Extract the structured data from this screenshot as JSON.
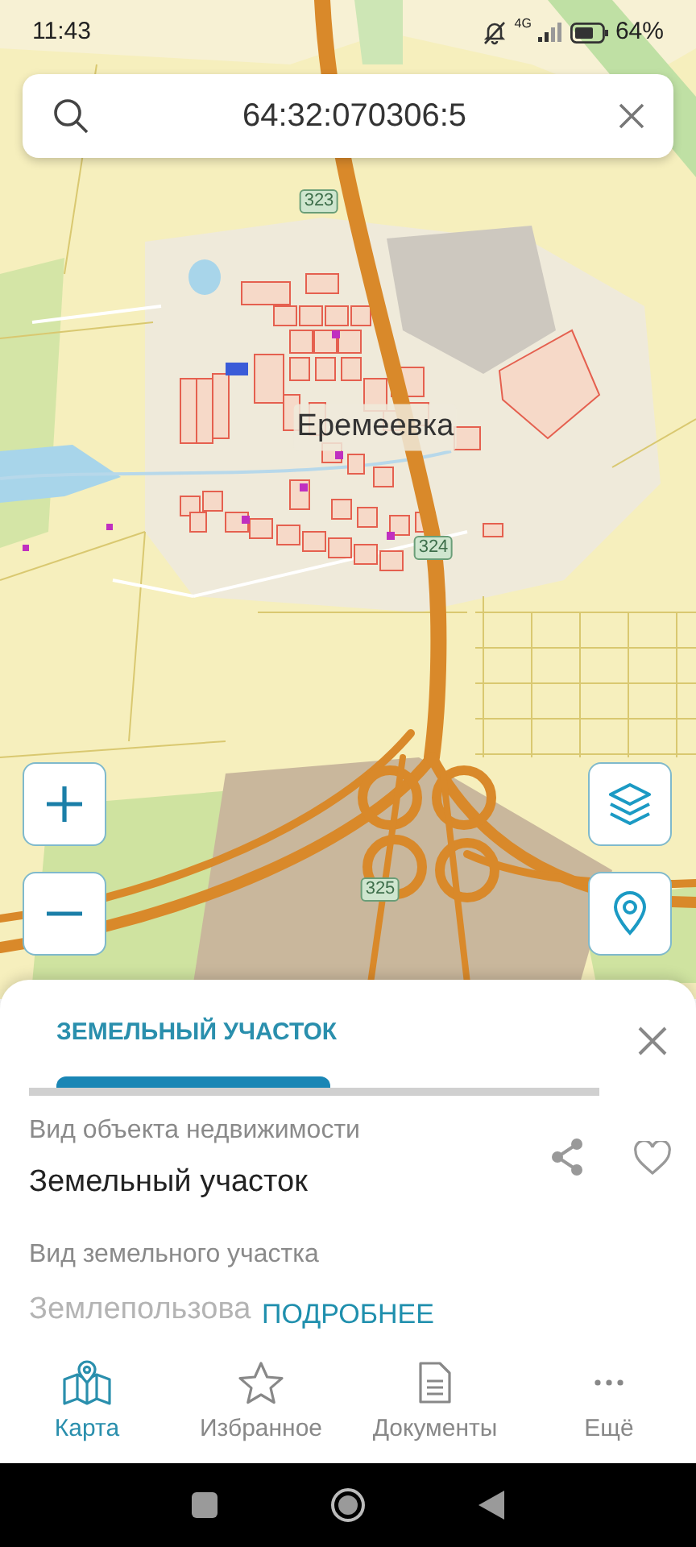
{
  "status_bar": {
    "time": "11:43",
    "network": "4G",
    "battery": "64%"
  },
  "search": {
    "value": "64:32:070306:5"
  },
  "map": {
    "labels": [
      {
        "kind": "road",
        "text": "323"
      },
      {
        "kind": "place",
        "text": "Еремеевка"
      },
      {
        "kind": "road",
        "text": "324"
      },
      {
        "kind": "road",
        "text": "325"
      }
    ]
  },
  "sheet": {
    "tabs": [
      {
        "label": "ЗЕМЕЛЬНЫЙ УЧАСТОК",
        "selected": true
      }
    ],
    "fields": [
      {
        "label": "Вид объекта недвижимости",
        "value": "Земельный участок",
        "faded": false
      },
      {
        "label": "Вид земельного участка",
        "value": "Землепользова",
        "faded": true
      }
    ],
    "more_link": "ПОДРОБНЕЕ",
    "favorite": false
  },
  "bottom_nav": [
    {
      "label": "Карта",
      "selected": true
    },
    {
      "label": "Избранное",
      "selected": false
    },
    {
      "label": "Документы",
      "selected": false
    },
    {
      "label": "Ещё",
      "selected": false
    }
  ]
}
